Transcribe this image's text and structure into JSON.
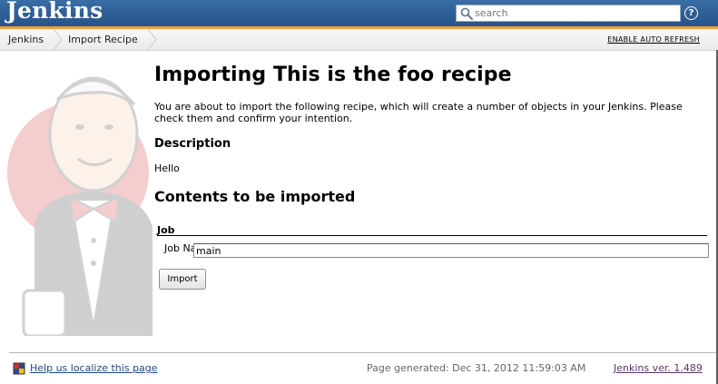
{
  "header": {
    "logo": "Jenkins",
    "search_placeholder": "search",
    "help_icon": "help-icon",
    "colors": {
      "bar": "#2d5e94",
      "stripe": "#f0a030"
    }
  },
  "breadcrumbs": {
    "items": [
      "Jenkins",
      "Import Recipe"
    ],
    "auto_refresh": "ENABLE AUTO REFRESH"
  },
  "main": {
    "title": "Importing This is the foo recipe",
    "intro": "You are about to import the following recipe, which will create a number of objects in your Jenkins. Please check them and confirm your intention.",
    "description_heading": "Description",
    "description_text": "Hello",
    "contents_heading": "Contents to be imported",
    "job_section_heading": "Job",
    "job_name_label": "Job Name",
    "job_name_value": "main",
    "import_button": "Import"
  },
  "footer": {
    "localize_link": "Help us localize this page",
    "page_generated": "Page generated: Dec 31, 2012 11:59:03 AM",
    "version_link": "Jenkins ver. 1.489"
  }
}
